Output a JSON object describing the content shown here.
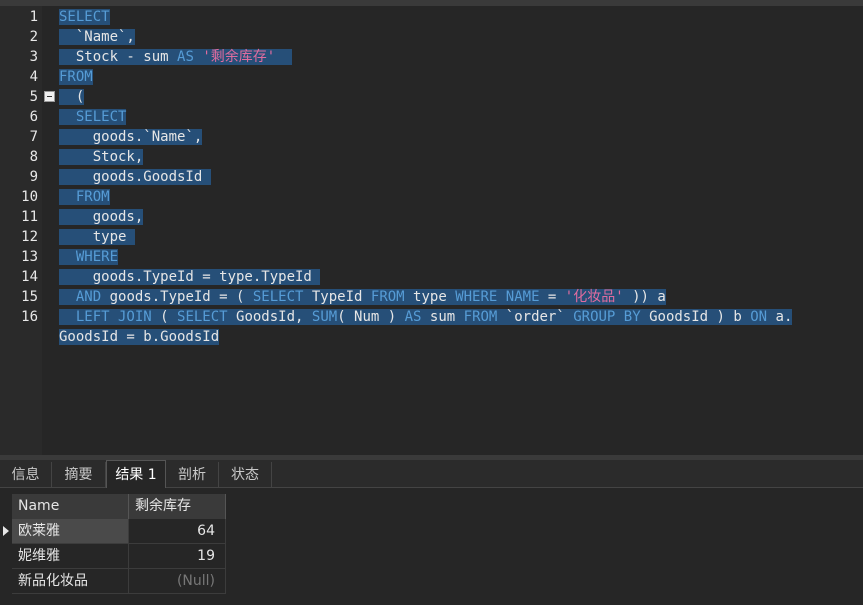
{
  "editor": {
    "line_numbers": [
      "1",
      "2",
      "3",
      "4",
      "5",
      "6",
      "7",
      "8",
      "9",
      "10",
      "11",
      "12",
      "13",
      "14",
      "15",
      "16"
    ],
    "lines": [
      [
        {
          "t": "SELECT",
          "c": "kw"
        }
      ],
      [
        {
          "t": "  `Name`,",
          "c": "tx"
        }
      ],
      [
        {
          "t": "  Stock - sum ",
          "c": "tx"
        },
        {
          "t": "AS",
          "c": "kw"
        },
        {
          "t": " ",
          "c": "tx"
        },
        {
          "t": "'剩余库存'",
          "c": "str"
        },
        {
          "t": "  ",
          "c": "tx"
        }
      ],
      [
        {
          "t": "FROM",
          "c": "kw"
        }
      ],
      [
        {
          "t": "  (",
          "c": "tx"
        }
      ],
      [
        {
          "t": "  ",
          "c": "tx"
        },
        {
          "t": "SELECT",
          "c": "kw"
        }
      ],
      [
        {
          "t": "    goods.`Name`,",
          "c": "tx"
        }
      ],
      [
        {
          "t": "    Stock,",
          "c": "tx"
        }
      ],
      [
        {
          "t": "    goods.GoodsId ",
          "c": "tx"
        }
      ],
      [
        {
          "t": "  ",
          "c": "tx"
        },
        {
          "t": "FROM",
          "c": "kw"
        }
      ],
      [
        {
          "t": "    goods,",
          "c": "tx"
        }
      ],
      [
        {
          "t": "    type ",
          "c": "tx"
        }
      ],
      [
        {
          "t": "  ",
          "c": "tx"
        },
        {
          "t": "WHERE",
          "c": "kw"
        }
      ],
      [
        {
          "t": "    goods.TypeId = type.TypeId ",
          "c": "tx"
        }
      ],
      [
        {
          "t": "  ",
          "c": "tx"
        },
        {
          "t": "AND",
          "c": "kw"
        },
        {
          "t": " goods.TypeId = ( ",
          "c": "tx"
        },
        {
          "t": "SELECT",
          "c": "kw"
        },
        {
          "t": " TypeId ",
          "c": "tx"
        },
        {
          "t": "FROM",
          "c": "kw"
        },
        {
          "t": " type ",
          "c": "tx"
        },
        {
          "t": "WHERE",
          "c": "kw"
        },
        {
          "t": " ",
          "c": "tx"
        },
        {
          "t": "NAME",
          "c": "kw"
        },
        {
          "t": " = ",
          "c": "tx"
        },
        {
          "t": "'化妆品'",
          "c": "str"
        },
        {
          "t": " )) a",
          "c": "tx"
        }
      ],
      [
        {
          "t": "  ",
          "c": "tx"
        },
        {
          "t": "LEFT JOIN",
          "c": "kw"
        },
        {
          "t": " ( ",
          "c": "tx"
        },
        {
          "t": "SELECT",
          "c": "kw"
        },
        {
          "t": " GoodsId, ",
          "c": "tx"
        },
        {
          "t": "SUM",
          "c": "kw"
        },
        {
          "t": "( Num ) ",
          "c": "tx"
        },
        {
          "t": "AS",
          "c": "kw"
        },
        {
          "t": " sum ",
          "c": "tx"
        },
        {
          "t": "FROM",
          "c": "kw"
        },
        {
          "t": " `order` ",
          "c": "tx"
        },
        {
          "t": "GROUP BY",
          "c": "kw"
        },
        {
          "t": " GoodsId ) b ",
          "c": "tx"
        },
        {
          "t": "ON",
          "c": "kw"
        },
        {
          "t": " a.",
          "c": "tx"
        }
      ],
      [
        {
          "t": "GoodsId = b.GoodsId",
          "c": "tx"
        }
      ]
    ]
  },
  "tabs": [
    {
      "label": "信息",
      "active": false
    },
    {
      "label": "摘要",
      "active": false
    },
    {
      "label": "结果 1",
      "active": true
    },
    {
      "label": "剖析",
      "active": false
    },
    {
      "label": "状态",
      "active": false
    }
  ],
  "result": {
    "columns": [
      "Name",
      "剩余库存"
    ],
    "rows": [
      {
        "name": "欧莱雅",
        "value": "64",
        "current": true
      },
      {
        "name": "妮维雅",
        "value": "19",
        "current": false
      },
      {
        "name": "新品化妆品",
        "value": "(Null)",
        "current": false
      }
    ]
  },
  "colors": {
    "selection": "#264f78",
    "keyword": "#569cd6",
    "string": "#e06c9f",
    "background": "#262626"
  }
}
